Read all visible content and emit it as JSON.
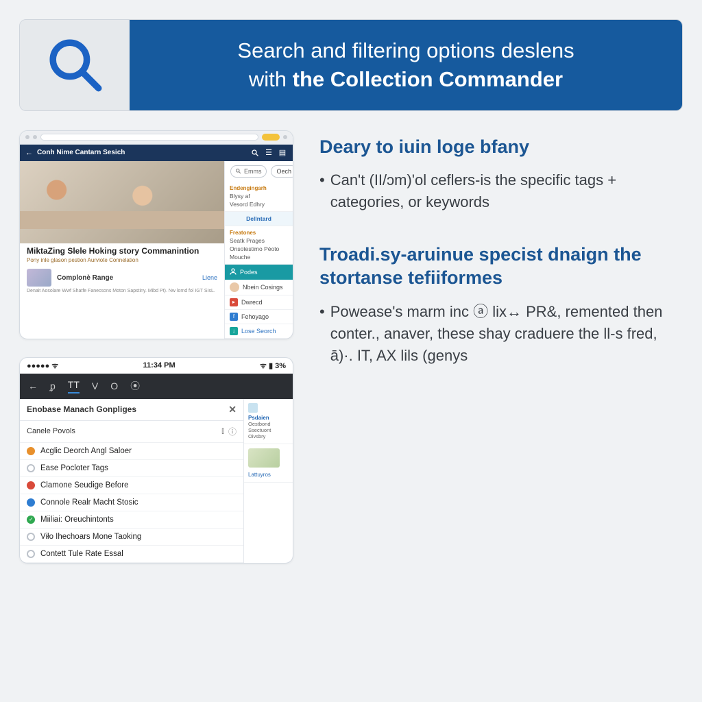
{
  "banner": {
    "line1": "Search and filtering options deslens",
    "line2_prefix": "with ",
    "line2_bold": "the Collection Commander"
  },
  "desktop": {
    "app_title": "Conh Nime Cantarn Sesich",
    "search_placeholder": "Emms",
    "filter_btn": "Oech",
    "sidebar": {
      "group1_head": "Endengingarh",
      "group1_items": [
        "Blysy af",
        "Vesord Edhry"
      ],
      "download_btn": "Dellntard",
      "group2_head": "Freatones",
      "group2_items": [
        "Seatk Prages",
        "Onsotestimo Péoto",
        "Mouche"
      ],
      "pill_label": "Podes",
      "user_label": "Nbein Cosings",
      "items": [
        {
          "icon": "r",
          "label": "Dwrecd"
        },
        {
          "icon": "b",
          "label": "Fehoyago"
        }
      ],
      "last_item": "Lose Seorch"
    },
    "article": {
      "title": "MiktaZing Slele Hoking story Commanintion",
      "subtitle": "Pony inle glason pestion Aurviote Connelation",
      "row_title": "Complonè Range",
      "row_more": "Liene",
      "small": "Denait Aosolare Wwf Shatfe Fanecsons Moton Sapstiny. Mibd Pt). Nw lomd fol IGT SIsL."
    }
  },
  "mobile": {
    "status_time": "11:34 PM",
    "status_right": "3%",
    "tabs": [
      "←",
      "ᵱ",
      "TT",
      "V",
      "O",
      "⦿"
    ],
    "panel_title": "Enobase Manach Gonpliges",
    "header_row": "Canele Povols",
    "items": [
      {
        "icon": "o",
        "label": "Acglic Deorch Angl Saloer"
      },
      {
        "icon": "",
        "label": "Ease Pocloter Tags"
      },
      {
        "icon": "r",
        "label": "Clamone Seudige Before"
      },
      {
        "icon": "b",
        "label": "Connole Realr Macht Stosic"
      },
      {
        "icon": "g",
        "label": "Miiliai: Oreuchintonts"
      },
      {
        "icon": "",
        "label": "Viło Ihechoars Mone Taoking"
      },
      {
        "icon": "",
        "label": "Contett Tule Rate Essal"
      }
    ],
    "sidecards": [
      {
        "head": "Psdaien",
        "body": "Oestbond Ssectuont Oivsbry",
        "link": ""
      },
      {
        "head": "",
        "body": "",
        "link": "Lattuyros"
      }
    ]
  },
  "sections": [
    {
      "title": "Deary to iuin loge bfany",
      "bullet": "Can't (II/ɔm)'ol ceflers-is the specific tags + categories, or keywords"
    },
    {
      "title": "Troadi.sy-aruinue specist dnaign the stortanse tefiiformes",
      "bullet": "Powease's marm inc ⓐ lix↔ PR&, remented then conter., anaver, these shay craduere the ll-s fred, ā)·. IT, AX lils (genys"
    }
  ]
}
